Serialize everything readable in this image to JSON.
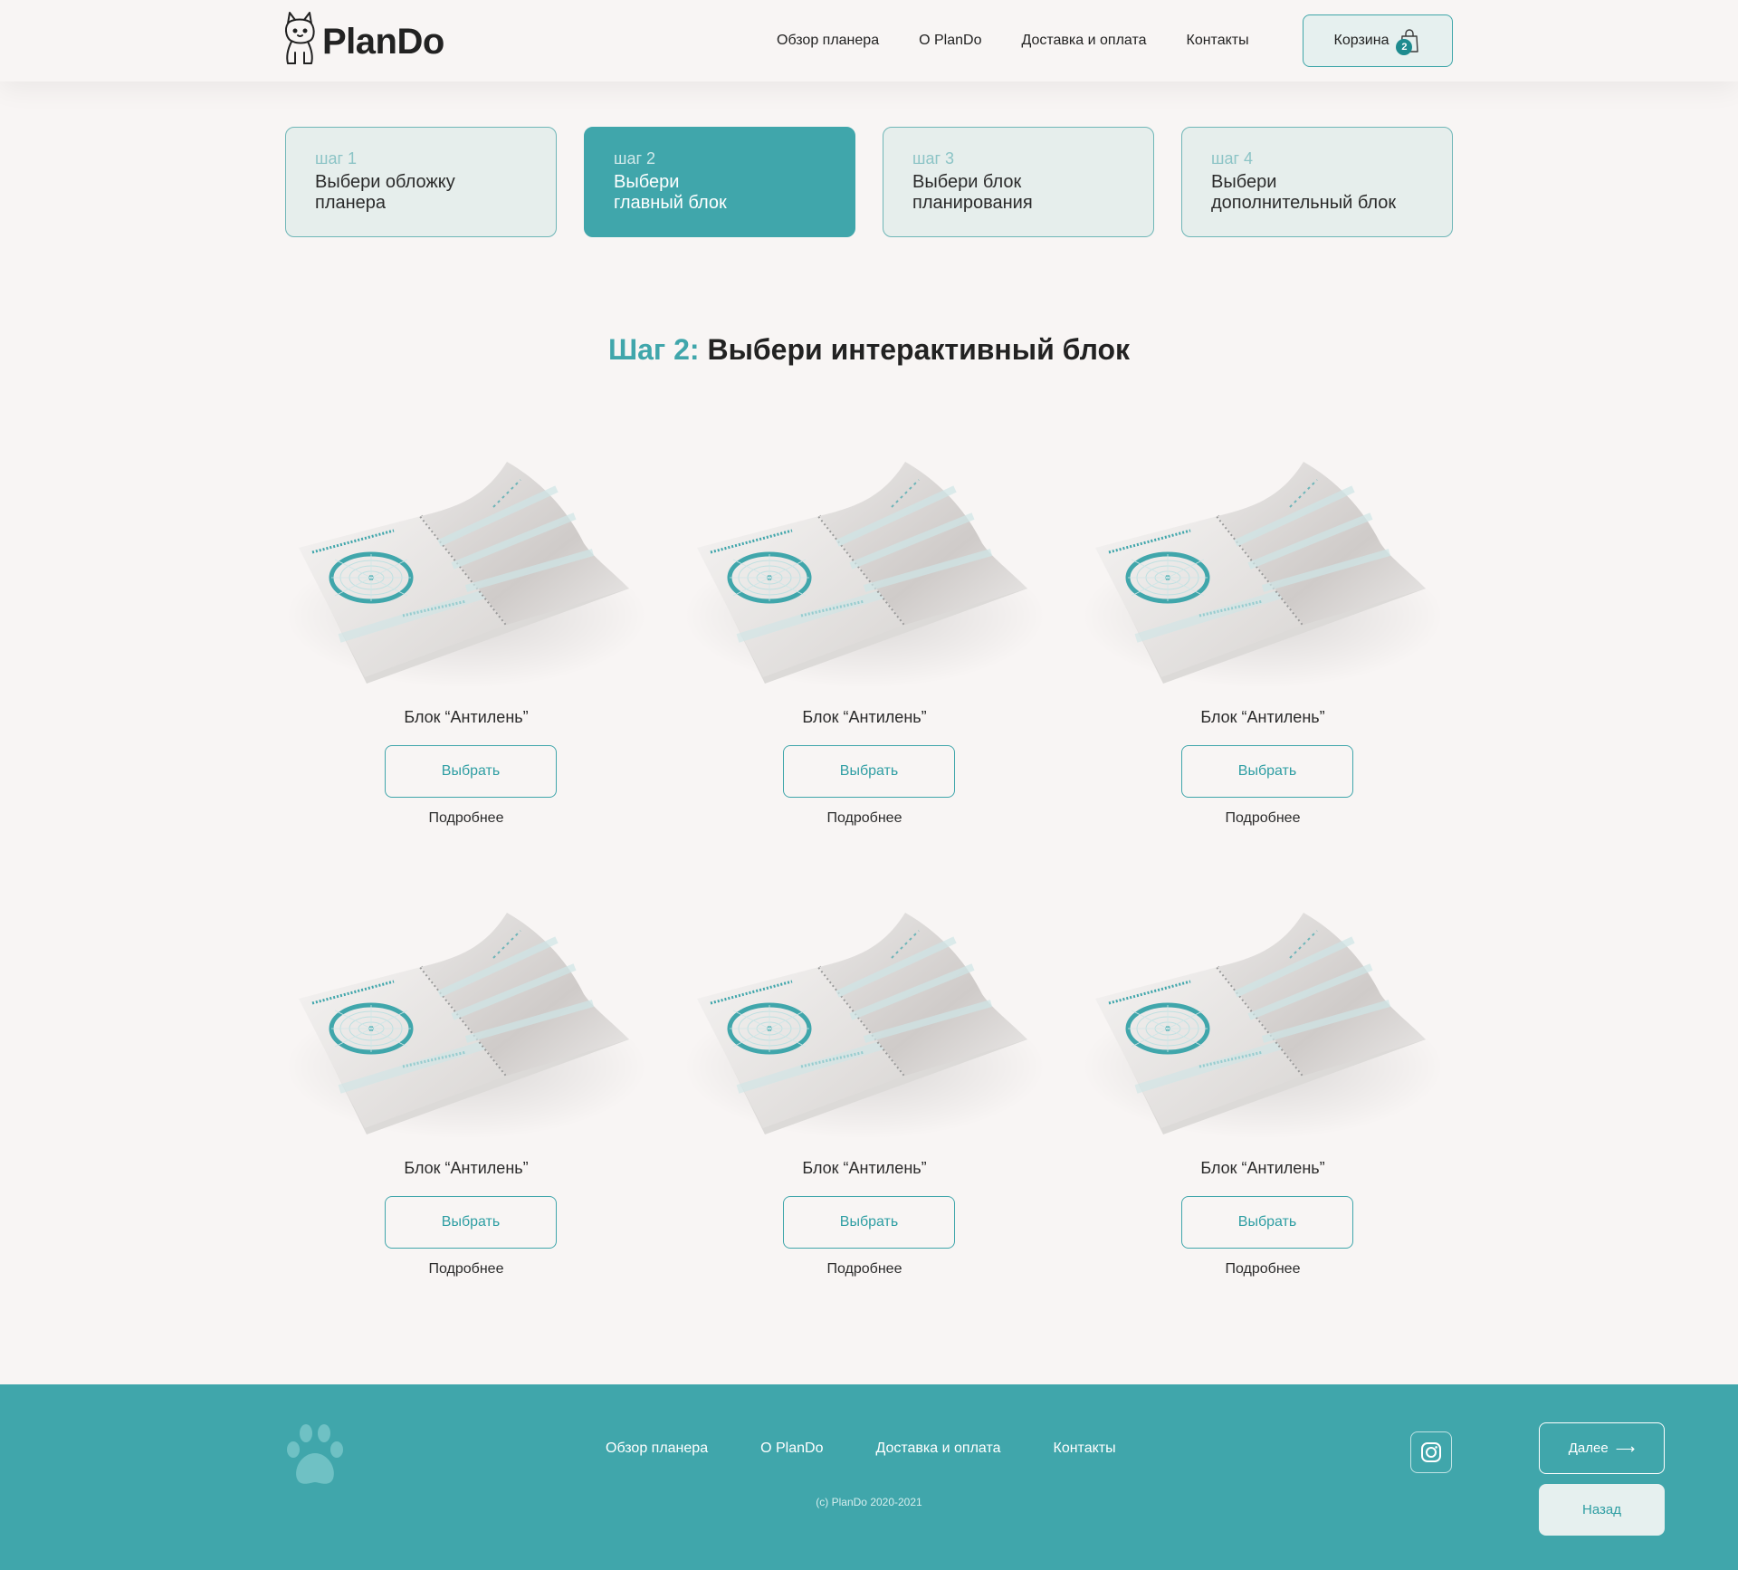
{
  "header": {
    "logo_text": "PlanDo",
    "nav": [
      "Обзор планера",
      "О PlanDo",
      "Доставка и оплата",
      "Контакты"
    ],
    "cart": {
      "label": "Корзина",
      "count": "2"
    }
  },
  "steps": [
    {
      "num": "шаг 1",
      "label": "Выбери обложку\nпланера",
      "active": false
    },
    {
      "num": "шаг 2",
      "label": "Выбери\nглавный блок",
      "active": true
    },
    {
      "num": "шаг 3",
      "label": "Выбери блок\nпланирования",
      "active": false
    },
    {
      "num": "шаг 4",
      "label": "Выбери\nдополнительный блок",
      "active": false
    }
  ],
  "page_title": {
    "accent": "Шаг 2:",
    "text": "Выбери интерактивный блок"
  },
  "products": [
    {
      "name": "Блок “Антилень”",
      "select": "Выбрать",
      "more": "Подробнее"
    },
    {
      "name": "Блок “Антилень”",
      "select": "Выбрать",
      "more": "Подробнее"
    },
    {
      "name": "Блок “Антилень”",
      "select": "Выбрать",
      "more": "Подробнее"
    },
    {
      "name": "Блок “Антилень”",
      "select": "Выбрать",
      "more": "Подробнее"
    },
    {
      "name": "Блок “Антилень”",
      "select": "Выбрать",
      "more": "Подробнее"
    },
    {
      "name": "Блок “Антилень”",
      "select": "Выбрать",
      "more": "Подробнее"
    }
  ],
  "footer": {
    "nav": [
      "Обзор планера",
      "О PlanDo",
      "Доставка и оплата",
      "Контакты"
    ],
    "copyright": "(c) PlanDo 2020-2021",
    "next": "Далее",
    "next_arrow": "⟶",
    "back": "Назад"
  },
  "colors": {
    "accent": "#40a6ab",
    "background": "#f8f5f4",
    "step_bg": "#e6eeec"
  },
  "icons": {
    "logo": "bulldog-icon",
    "cart": "shopping-bag-icon",
    "footer": "paw-icon",
    "social": "instagram-icon"
  }
}
